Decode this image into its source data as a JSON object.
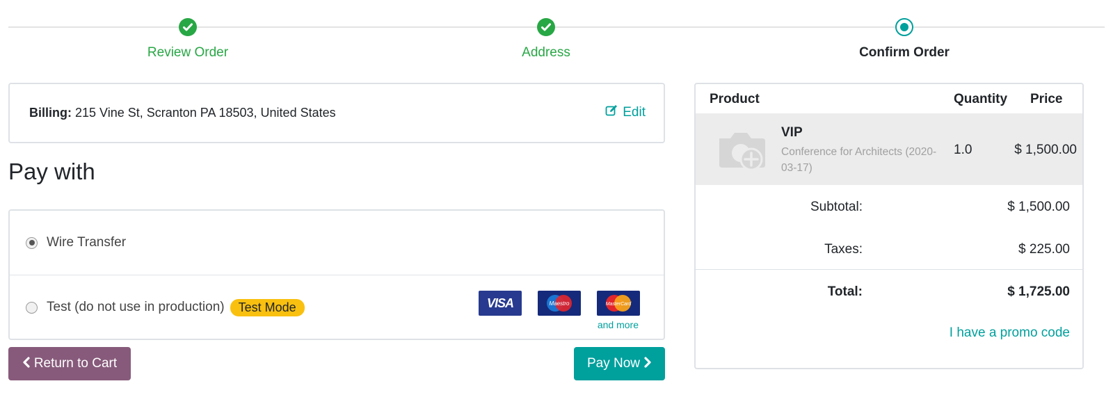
{
  "wizard": {
    "steps": [
      {
        "label": "Review Order",
        "state": "done"
      },
      {
        "label": "Address",
        "state": "done"
      },
      {
        "label": "Confirm Order",
        "state": "current"
      }
    ]
  },
  "billing": {
    "label": "Billing:",
    "address": "215 Vine St, Scranton PA 18503, United States",
    "edit_label": "Edit"
  },
  "pay_with": {
    "heading": "Pay with",
    "options": [
      {
        "label": "Wire Transfer",
        "checked": true
      },
      {
        "label": "Test (do not use in production)",
        "checked": false,
        "badge": "Test Mode"
      }
    ],
    "card_logos": [
      "VISA",
      "Maestro",
      "MasterCard"
    ],
    "and_more": "and more"
  },
  "buttons": {
    "return_label": "Return to Cart",
    "pay_label": "Pay Now"
  },
  "summary": {
    "headers": {
      "product": "Product",
      "quantity": "Quantity",
      "price": "Price"
    },
    "item": {
      "name": "VIP",
      "description": "Conference for Architects (2020-03-17)",
      "quantity": "1.0",
      "price": "$ 1,500.00"
    },
    "subtotal_label": "Subtotal:",
    "subtotal_value": "$ 1,500.00",
    "taxes_label": "Taxes:",
    "taxes_value": "$ 225.00",
    "total_label": "Total:",
    "total_value": "$ 1,725.00",
    "promo_label": "I have a promo code"
  },
  "colors": {
    "done": "#28a745",
    "accent": "#00a09d",
    "return_button": "#875a7b",
    "badge": "#f9c00f"
  }
}
